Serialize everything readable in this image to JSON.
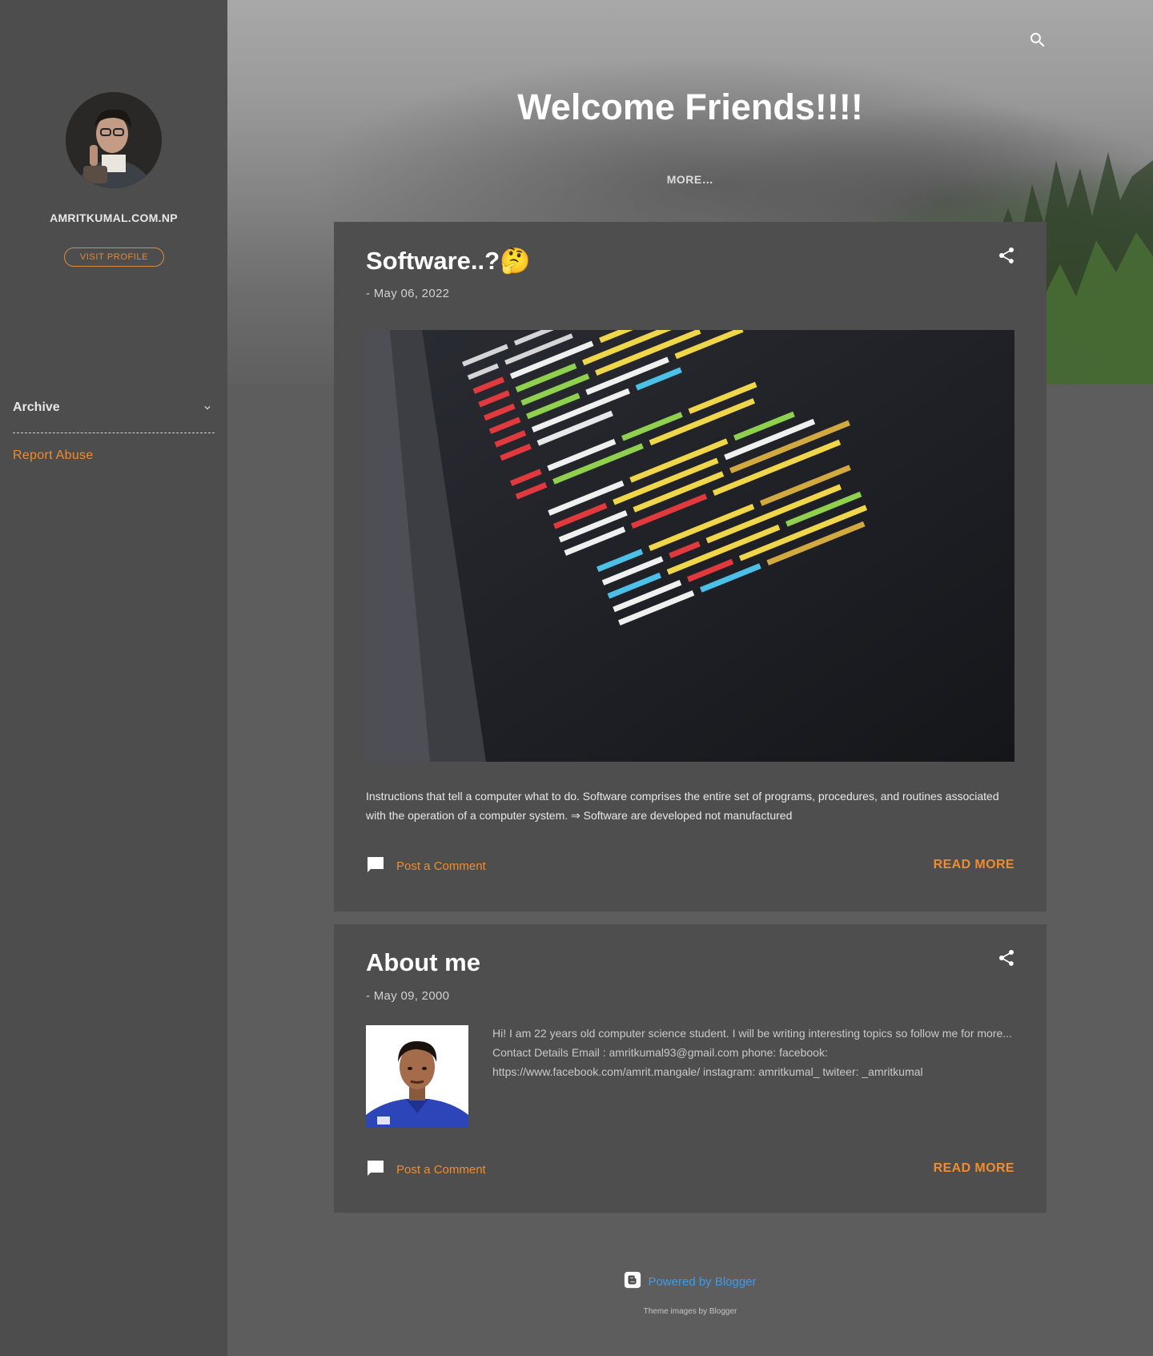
{
  "sidebar": {
    "blog_name": "AMRITKUMAL.COM.NP",
    "visit_profile": "VISIT PROFILE",
    "archive_label": "Archive",
    "report_abuse": "Report Abuse"
  },
  "header": {
    "title": "Welcome Friends!!!!",
    "more": "MORE…",
    "search_icon": "search-icon"
  },
  "posts": [
    {
      "title": "Software..?🤔",
      "date": "- May 06, 2022",
      "snippet": "Instructions that tell a computer what to do. Software comprises the entire set of programs, procedures, and routines associated with the operation of a computer system. ⇒ Software are developed not manufactured",
      "comment_link": "Post a Comment",
      "read_more": "READ MORE"
    },
    {
      "title": "About me",
      "date": "- May 09, 2000",
      "snippet": "Hi!  I am 22 years old computer science student. I will be writing interesting topics so follow me for more... Contact Details Email : amritkumal93@gmail.com phone: facebook: https://www.facebook.com/amrit.mangale/ instagram:  amritkumal_ twiteer:  _amritkumal",
      "comment_link": "Post a Comment",
      "read_more": "READ MORE"
    }
  ],
  "footer": {
    "powered_by": "Powered by Blogger",
    "theme_credit": "Theme images by Blogger"
  },
  "colors": {
    "accent": "#f08c2e",
    "link": "#3d9be9",
    "sidebar_bg": "#4d4d4d",
    "page_bg": "#5d5d5d",
    "post_bg": "#4e4e4e"
  }
}
